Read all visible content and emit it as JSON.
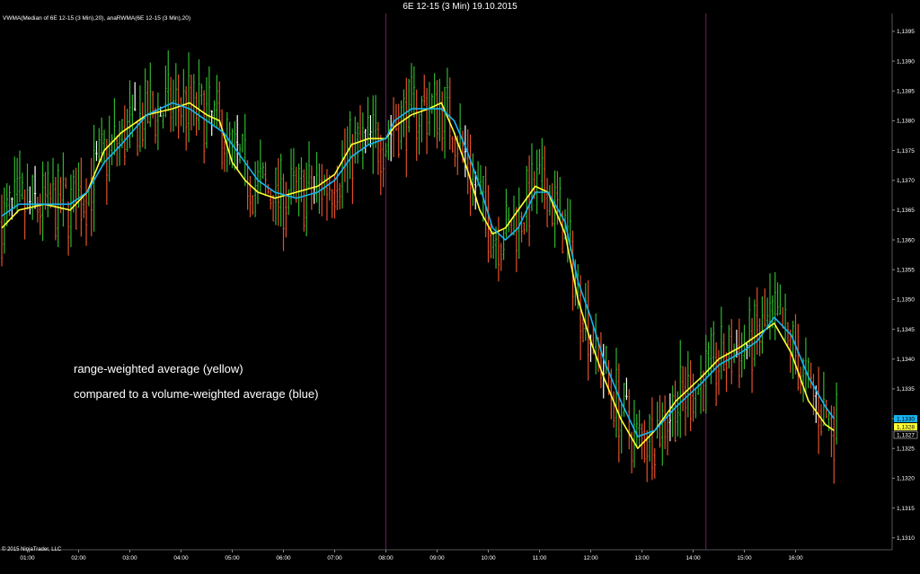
{
  "window": {
    "title": "6E 12-15 (3 Min)  19.10.2015"
  },
  "indicator_label": "VWMA(Median of 6E 12-15 (3 Min),20), anaRWMA(6E 12-15 (3 Min),20)",
  "copyright": "© 2015 NinjaTrader, LLC",
  "annotations": [
    "range-weighted average (yellow)",
    "compared to a volume-weighted average (blue)"
  ],
  "price_labels": {
    "blue": "1,1330",
    "yellow": "1,1328",
    "last": "1,1327"
  },
  "colors": {
    "background": "#000000",
    "up_bar": "#2fb52f",
    "down_bar": "#e0502a",
    "doji_bar": "#ffffff",
    "yellow_line": "#ffff33",
    "blue_line": "#19b4f0",
    "session_line": "#6b1a6b",
    "axis": "#555555"
  },
  "chart_data": {
    "type": "line",
    "title": "6E 12-15 (3 Min)  19.10.2015",
    "xlabel": "",
    "ylabel": "",
    "x_ticks": [
      "01:00",
      "02:00",
      "03:00",
      "04:00",
      "05:00",
      "06:00",
      "07:00",
      "08:00",
      "09:00",
      "10:00",
      "11:00",
      "12:00",
      "13:00",
      "14:00",
      "15:00",
      "16:00"
    ],
    "y_ticks": [
      "1,1395",
      "1,1390",
      "1,1385",
      "1,1380",
      "1,1375",
      "1,1370",
      "1,1365",
      "1,1360",
      "1,1355",
      "1,1350",
      "1,1345",
      "1,1340",
      "1,1335",
      "1,1330",
      "1,1325",
      "1,1320",
      "1,1315",
      "1,1310"
    ],
    "ylim": [
      1.1308,
      1.1398
    ],
    "xlim": [
      "00:30",
      "17:50"
    ],
    "session_breaks": [
      "08:00",
      "14:15"
    ],
    "grid": false,
    "series": [
      {
        "name": "anaRWMA(6E 12-15 (3 Min),20)",
        "color": "yellow",
        "points": [
          [
            "00:30",
            1.1362
          ],
          [
            "00:50",
            1.1365
          ],
          [
            "01:20",
            1.1366
          ],
          [
            "01:50",
            1.1365
          ],
          [
            "02:10",
            1.1368
          ],
          [
            "02:30",
            1.1375
          ],
          [
            "02:50",
            1.1378
          ],
          [
            "03:20",
            1.1381
          ],
          [
            "03:50",
            1.1382
          ],
          [
            "04:10",
            1.1383
          ],
          [
            "04:30",
            1.1381
          ],
          [
            "04:45",
            1.138
          ],
          [
            "05:00",
            1.1373
          ],
          [
            "05:15",
            1.137
          ],
          [
            "05:30",
            1.1368
          ],
          [
            "05:50",
            1.1367
          ],
          [
            "06:15",
            1.1368
          ],
          [
            "06:40",
            1.1369
          ],
          [
            "07:00",
            1.1371
          ],
          [
            "07:20",
            1.1376
          ],
          [
            "07:40",
            1.1377
          ],
          [
            "08:00",
            1.1377
          ],
          [
            "08:10",
            1.1379
          ],
          [
            "08:30",
            1.1381
          ],
          [
            "08:50",
            1.1382
          ],
          [
            "09:05",
            1.1383
          ],
          [
            "09:20",
            1.1378
          ],
          [
            "09:35",
            1.1372
          ],
          [
            "09:50",
            1.1365
          ],
          [
            "10:05",
            1.1361
          ],
          [
            "10:20",
            1.1362
          ],
          [
            "10:35",
            1.1365
          ],
          [
            "10:55",
            1.1369
          ],
          [
            "11:10",
            1.1368
          ],
          [
            "11:30",
            1.1361
          ],
          [
            "11:45",
            1.135
          ],
          [
            "12:00",
            1.1343
          ],
          [
            "12:15",
            1.1337
          ],
          [
            "12:35",
            1.133
          ],
          [
            "12:55",
            1.1325
          ],
          [
            "13:15",
            1.1328
          ],
          [
            "13:40",
            1.1333
          ],
          [
            "14:10",
            1.1337
          ],
          [
            "14:30",
            1.134
          ],
          [
            "14:55",
            1.1342
          ],
          [
            "15:15",
            1.1344
          ],
          [
            "15:35",
            1.1346
          ],
          [
            "15:55",
            1.1341
          ],
          [
            "16:15",
            1.1333
          ],
          [
            "16:35",
            1.1329
          ],
          [
            "16:45",
            1.1328
          ]
        ]
      },
      {
        "name": "VWMA(Median of 6E 12-15 (3 Min),20)",
        "color": "blue",
        "points": [
          [
            "00:30",
            1.1364
          ],
          [
            "00:50",
            1.1366
          ],
          [
            "01:20",
            1.1366
          ],
          [
            "01:50",
            1.1366
          ],
          [
            "02:10",
            1.1368
          ],
          [
            "02:30",
            1.1373
          ],
          [
            "02:50",
            1.1376
          ],
          [
            "03:20",
            1.1381
          ],
          [
            "03:50",
            1.1383
          ],
          [
            "04:10",
            1.1382
          ],
          [
            "04:30",
            1.138
          ],
          [
            "04:50",
            1.1378
          ],
          [
            "05:10",
            1.1374
          ],
          [
            "05:30",
            1.137
          ],
          [
            "05:50",
            1.1368
          ],
          [
            "06:15",
            1.1367
          ],
          [
            "06:40",
            1.1368
          ],
          [
            "07:00",
            1.137
          ],
          [
            "07:20",
            1.1374
          ],
          [
            "07:40",
            1.1376
          ],
          [
            "08:00",
            1.1377
          ],
          [
            "08:10",
            1.138
          ],
          [
            "08:30",
            1.1382
          ],
          [
            "08:50",
            1.1382
          ],
          [
            "09:05",
            1.1382
          ],
          [
            "09:20",
            1.138
          ],
          [
            "09:35",
            1.1375
          ],
          [
            "09:50",
            1.1369
          ],
          [
            "10:05",
            1.1362
          ],
          [
            "10:20",
            1.136
          ],
          [
            "10:35",
            1.1362
          ],
          [
            "10:55",
            1.1368
          ],
          [
            "11:10",
            1.1368
          ],
          [
            "11:30",
            1.1363
          ],
          [
            "11:45",
            1.1353
          ],
          [
            "12:00",
            1.1347
          ],
          [
            "12:15",
            1.134
          ],
          [
            "12:35",
            1.1333
          ],
          [
            "12:55",
            1.1327
          ],
          [
            "13:15",
            1.1328
          ],
          [
            "13:40",
            1.1332
          ],
          [
            "14:10",
            1.1336
          ],
          [
            "14:30",
            1.1339
          ],
          [
            "14:55",
            1.1341
          ],
          [
            "15:15",
            1.1343
          ],
          [
            "15:35",
            1.1347
          ],
          [
            "15:55",
            1.1344
          ],
          [
            "16:15",
            1.1337
          ],
          [
            "16:35",
            1.1332
          ],
          [
            "16:45",
            1.133
          ]
        ]
      }
    ]
  }
}
